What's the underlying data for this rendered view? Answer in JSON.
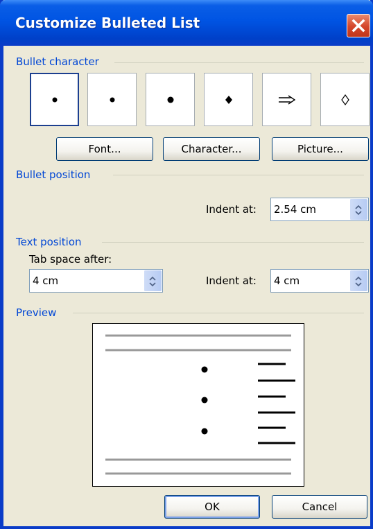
{
  "window": {
    "title": "Customize Bulleted List"
  },
  "bullet_character": {
    "group_label": "Bullet character",
    "tiles": [
      {
        "glyph": "•",
        "selected": true
      },
      {
        "glyph": "•",
        "selected": false
      },
      {
        "glyph": "•",
        "selected": false
      },
      {
        "glyph": "♦",
        "selected": false
      },
      {
        "glyph": "⇨",
        "selected": false
      },
      {
        "glyph": "◊",
        "selected": false
      }
    ],
    "buttons": {
      "font": "Font...",
      "character": "Character...",
      "picture": "Picture..."
    }
  },
  "bullet_position": {
    "group_label": "Bullet position",
    "indent_label": "Indent at:",
    "indent_value": "2.54 cm"
  },
  "text_position": {
    "group_label": "Text position",
    "tab_space_label": "Tab space after:",
    "tab_space_value": "4 cm",
    "indent_label": "Indent at:",
    "indent_value": "4 cm"
  },
  "preview": {
    "group_label": "Preview"
  },
  "footer": {
    "ok": "OK",
    "cancel": "Cancel"
  },
  "colors": {
    "titlebar": "#0054e3",
    "group_label": "#0046d5",
    "dialog_bg": "#ece9d8",
    "close": "#d4452a"
  },
  "icons": {
    "close": "close-x-icon",
    "spin": "spin-arrows-icon"
  }
}
